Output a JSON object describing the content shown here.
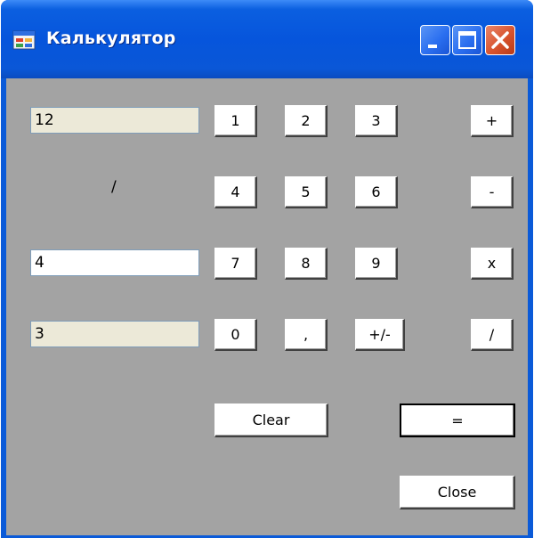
{
  "window": {
    "title": "Калькулятор",
    "icon": "app-window-icon",
    "controls": [
      "minimize-icon",
      "maximize-icon",
      "close-icon"
    ]
  },
  "fields": {
    "operand1": "12",
    "operator": "/",
    "operand2": "4",
    "result": "3"
  },
  "keypad": {
    "digits": [
      "1",
      "2",
      "3",
      "4",
      "5",
      "6",
      "7",
      "8",
      "9",
      "0"
    ],
    "decimal": ",",
    "sign": "+/-",
    "ops": {
      "add": "+",
      "sub": "-",
      "mul": "x",
      "div": "/"
    }
  },
  "actions": {
    "clear": "Clear",
    "equals": "=",
    "close": "Close"
  },
  "colors": {
    "titlebar": "#0655dc",
    "client_bg": "#a3a3a3",
    "readonly_field": "#ece9d8",
    "close_button": "#d8532d"
  }
}
